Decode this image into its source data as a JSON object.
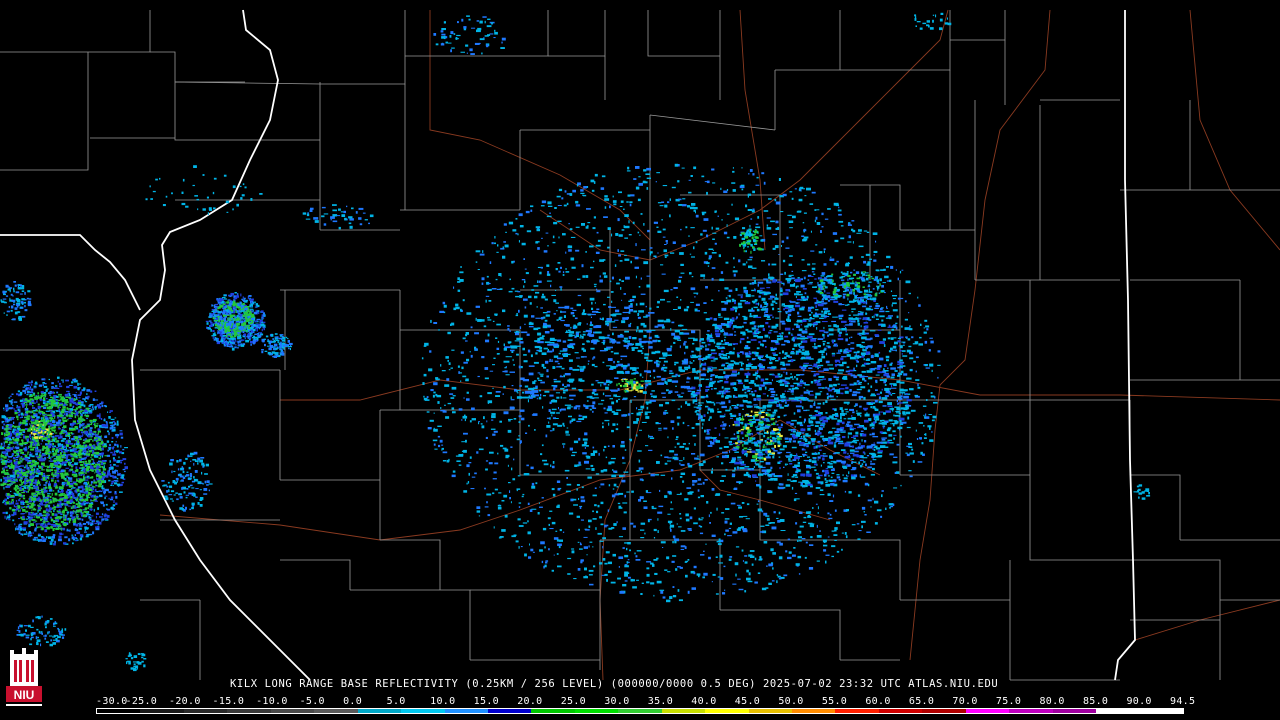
{
  "product": {
    "caption": "KILX LONG RANGE BASE REFLECTIVITY (0.25KM / 256 LEVEL) (000000/0000 0.5 DEG) 2025-07-02 23:32 UTC  ATLAS.NIU.EDU",
    "station": "KILX",
    "timestamp": "2025-07-02 23:32 UTC",
    "source": "ATLAS.NIU.EDU"
  },
  "logo": {
    "text": "NIU",
    "color": "#c8102e"
  },
  "scale": {
    "labels": [
      "-30.0",
      "-25.0",
      "-20.0",
      "-15.0",
      "-10.0",
      "-5.0",
      "0.0",
      "5.0",
      "10.0",
      "15.0",
      "20.0",
      "25.0",
      "30.0",
      "35.0",
      "40.0",
      "45.0",
      "50.0",
      "55.0",
      "60.0",
      "65.0",
      "70.0",
      "75.0",
      "80.0",
      "85.0",
      "90.0",
      "94.5"
    ],
    "colors": [
      "#000000",
      "#1a1a1a",
      "#2a2a2a",
      "#3a3a3a",
      "#4a4a4a",
      "#5a5a5a",
      "#00a8c8",
      "#00c8f0",
      "#1e90ff",
      "#0000cd",
      "#00c800",
      "#00e000",
      "#32cd32",
      "#c8e000",
      "#ffff00",
      "#e8c000",
      "#ff8c00",
      "#ff2000",
      "#d00000",
      "#b00000",
      "#ff00ff",
      "#c000c0",
      "#a000a0",
      "#ffffff",
      "#ffffff"
    ]
  },
  "map_style": {
    "county_lines": "#9a9a9a",
    "state_lines": "#ffffff",
    "highways": "#8a3a20",
    "echo_light": "#00b4e6",
    "echo_mid": "#1e78ff",
    "echo_blue": "#2040e0",
    "echo_green": "#22c83c",
    "echo_yellow": "#e8e840"
  }
}
